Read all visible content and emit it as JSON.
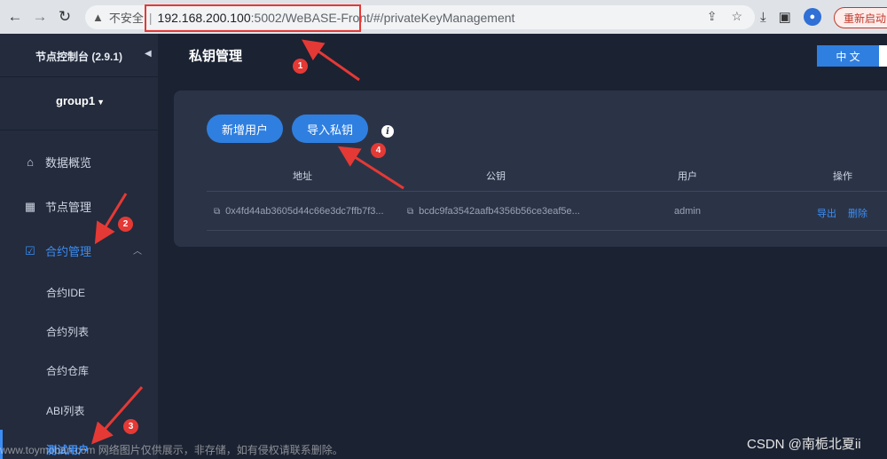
{
  "browser": {
    "address_warning": "不安全",
    "url_host": "192.168.200.100",
    "url_path": ":5002/WeBASE-Front/#/privateKeyManagement",
    "relaunch_label": "重新启动",
    "icons": [
      "back-icon",
      "forward-icon",
      "reload-icon",
      "warning-icon",
      "share-icon",
      "star-icon",
      "download-icon",
      "side-panel-icon",
      "profile-icon"
    ]
  },
  "sidebar": {
    "title": "节点控制台 (2.9.1)",
    "group": "group1",
    "menu": [
      {
        "label": "数据概览",
        "icon": "home-icon"
      },
      {
        "label": "节点管理",
        "icon": "calendar-icon"
      },
      {
        "label": "合约管理",
        "icon": "clipboard-check-icon"
      }
    ],
    "submenu": [
      "合约IDE",
      "合约列表",
      "合约仓库",
      "ABI列表",
      "测试用户"
    ]
  },
  "header": {
    "title": "私钥管理",
    "language": "中 文"
  },
  "toolbar": {
    "add_user": "新增用户",
    "import_key": "导入私钥"
  },
  "table": {
    "columns": [
      "地址",
      "公钥",
      "用户",
      "操作"
    ],
    "rows": [
      {
        "address": "0x4fd44ab3605d44c66e3dc7ffb7f3...",
        "public_key": "bcdc9fa3542aafb4356b56ce3eaf5e...",
        "user": "admin",
        "actions": [
          "导出",
          "删除"
        ]
      }
    ]
  },
  "annotations": [
    "1",
    "2",
    "3",
    "4"
  ],
  "watermark": {
    "left": "www.toymoban.com 网络图片仅供展示，非存储，如有侵权请联系删除。",
    "right": "CSDN @南栀北夏ii"
  },
  "colors": {
    "accent": "#2f7fe0",
    "annotation": "#e53935",
    "background": "#1b2232",
    "sidebar": "#232b3c",
    "card": "#2b3447"
  }
}
